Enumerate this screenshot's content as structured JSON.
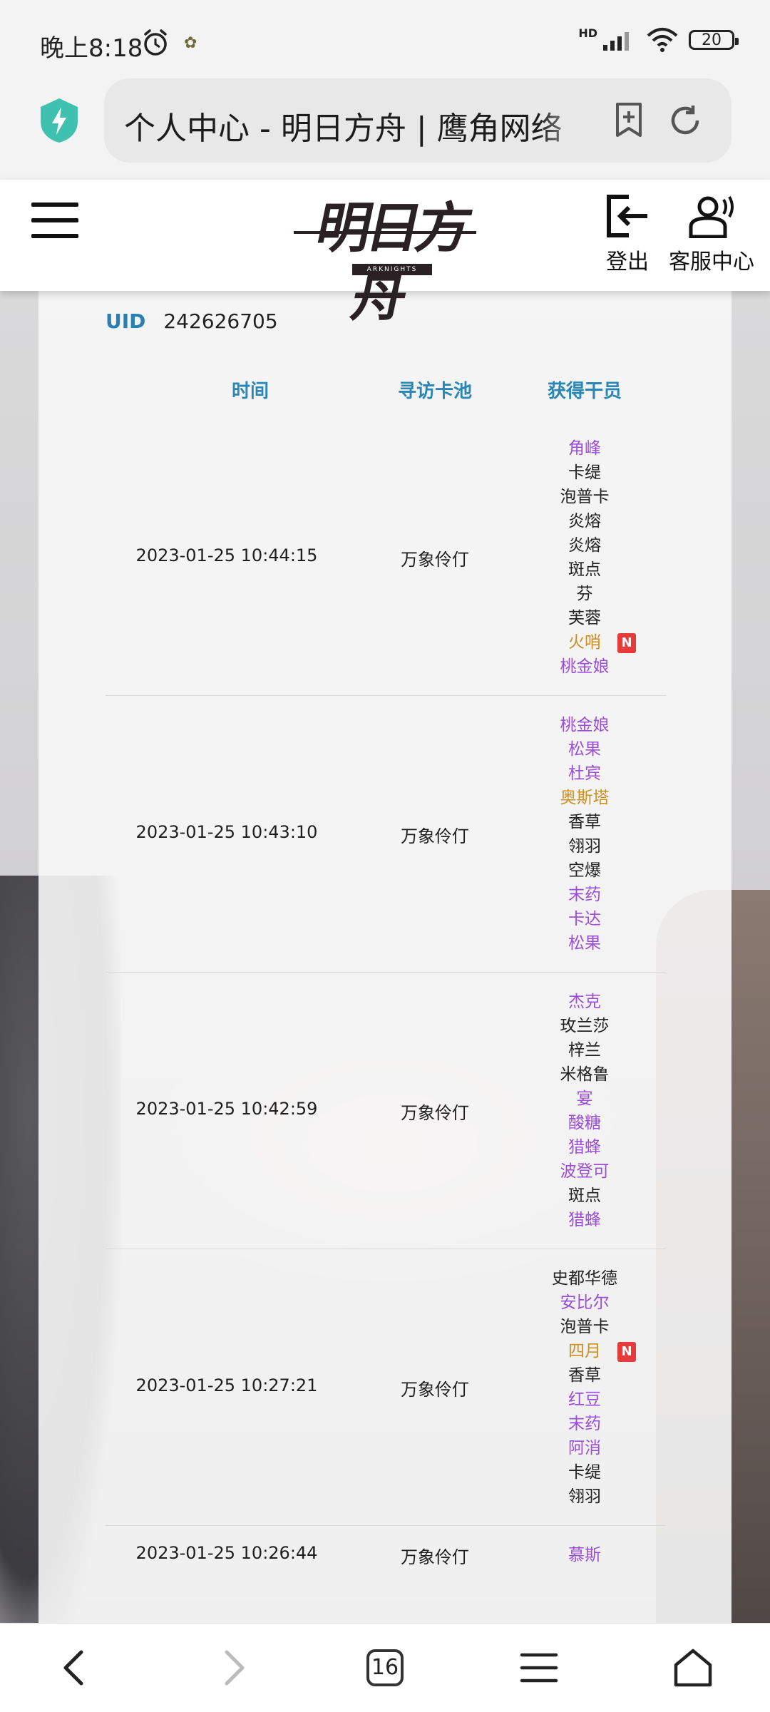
{
  "status_bar": {
    "time": "晚上8:18",
    "network": "HD",
    "battery": "20"
  },
  "browser": {
    "url_text": "个人中心 - 明日方舟 | 鹰角网络"
  },
  "header": {
    "logo_text": "明日方舟",
    "logo_sub": "ARKNIGHTS",
    "logout_label": "登出",
    "service_label": "客服中心"
  },
  "account": {
    "uid_label": "UID",
    "uid": "242626705"
  },
  "table": {
    "headers": {
      "time": "时间",
      "pool": "寻访卡池",
      "operators": "获得干员"
    },
    "records": [
      {
        "time": "2023-01-25 10:44:15",
        "pool": "万象伶仃",
        "operators": [
          {
            "name": "角峰",
            "rarity": 4
          },
          {
            "name": "卡缇",
            "rarity": 3
          },
          {
            "name": "泡普卡",
            "rarity": 3
          },
          {
            "name": "炎熔",
            "rarity": 3
          },
          {
            "name": "炎熔",
            "rarity": 3
          },
          {
            "name": "斑点",
            "rarity": 3
          },
          {
            "name": "芬",
            "rarity": 3
          },
          {
            "name": "芙蓉",
            "rarity": 3
          },
          {
            "name": "火哨",
            "rarity": 5,
            "new": "N"
          },
          {
            "name": "桃金娘",
            "rarity": 4
          }
        ]
      },
      {
        "time": "2023-01-25 10:43:10",
        "pool": "万象伶仃",
        "operators": [
          {
            "name": "桃金娘",
            "rarity": 4
          },
          {
            "name": "松果",
            "rarity": 4
          },
          {
            "name": "杜宾",
            "rarity": 4
          },
          {
            "name": "奥斯塔",
            "rarity": 5
          },
          {
            "name": "香草",
            "rarity": 3
          },
          {
            "name": "翎羽",
            "rarity": 3
          },
          {
            "name": "空爆",
            "rarity": 3
          },
          {
            "name": "末药",
            "rarity": 4
          },
          {
            "name": "卡达",
            "rarity": 4
          },
          {
            "name": "松果",
            "rarity": 4
          }
        ]
      },
      {
        "time": "2023-01-25 10:42:59",
        "pool": "万象伶仃",
        "operators": [
          {
            "name": "杰克",
            "rarity": 4
          },
          {
            "name": "玫兰莎",
            "rarity": 3
          },
          {
            "name": "梓兰",
            "rarity": 3
          },
          {
            "name": "米格鲁",
            "rarity": 3
          },
          {
            "name": "宴",
            "rarity": 4
          },
          {
            "name": "酸糖",
            "rarity": 4
          },
          {
            "name": "猎蜂",
            "rarity": 4
          },
          {
            "name": "波登可",
            "rarity": 4
          },
          {
            "name": "斑点",
            "rarity": 3
          },
          {
            "name": "猎蜂",
            "rarity": 4
          }
        ]
      },
      {
        "time": "2023-01-25 10:27:21",
        "pool": "万象伶仃",
        "operators": [
          {
            "name": "史都华德",
            "rarity": 3
          },
          {
            "name": "安比尔",
            "rarity": 4
          },
          {
            "name": "泡普卡",
            "rarity": 3
          },
          {
            "name": "四月",
            "rarity": 5,
            "new": "N"
          },
          {
            "name": "香草",
            "rarity": 3
          },
          {
            "name": "红豆",
            "rarity": 4
          },
          {
            "name": "末药",
            "rarity": 4
          },
          {
            "name": "阿消",
            "rarity": 4
          },
          {
            "name": "卡缇",
            "rarity": 3
          },
          {
            "name": "翎羽",
            "rarity": 3
          }
        ]
      },
      {
        "time": "2023-01-25 10:26:44",
        "pool": "万象伶仃",
        "operators": [
          {
            "name": "慕斯",
            "rarity": 4
          }
        ]
      }
    ]
  },
  "nav": {
    "tab_count": "16"
  },
  "colors": {
    "accent": "#2a86b5",
    "rarity3": "#222222",
    "rarity4": "#9b4fd8",
    "rarity5": "#cf8f1f",
    "new_badge": "#e53b3b"
  }
}
